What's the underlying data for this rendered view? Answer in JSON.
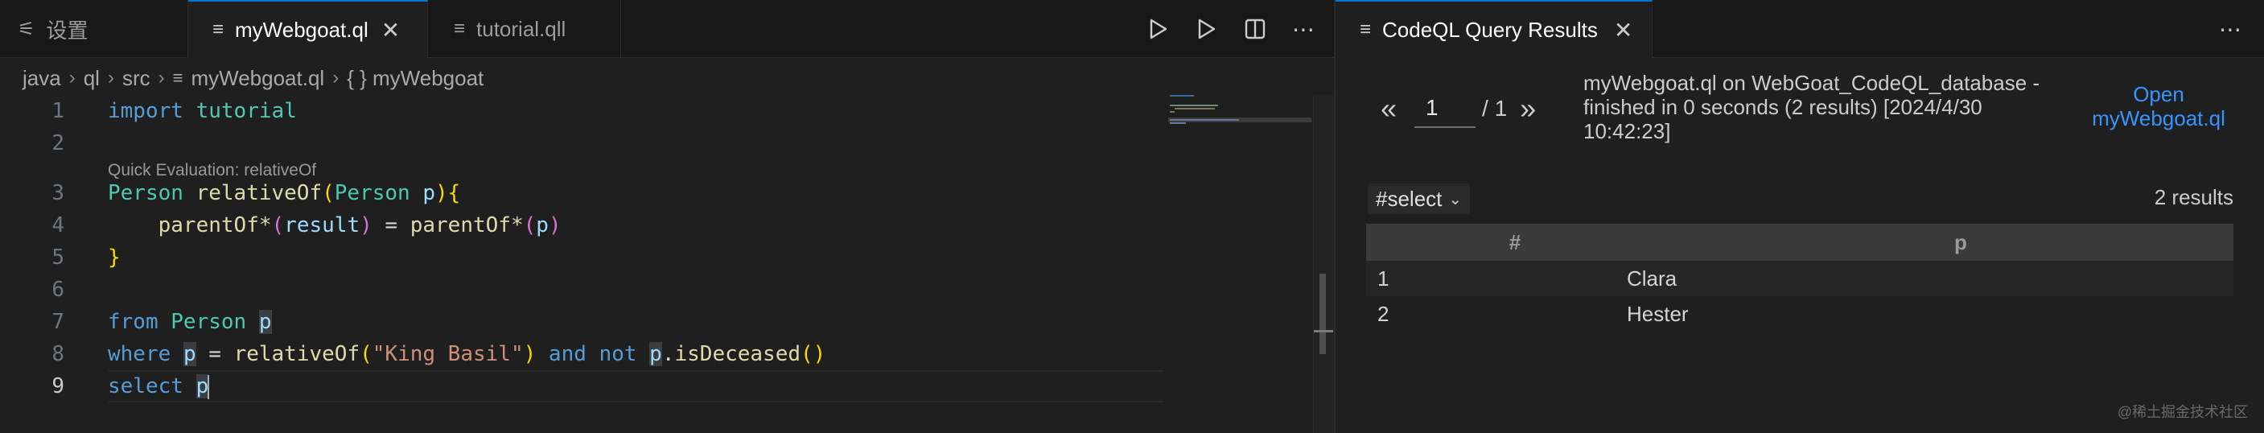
{
  "editor": {
    "tabs": [
      {
        "icon": "settings-icon",
        "label": "设置"
      },
      {
        "icon": "file-lines-icon",
        "label": "myWebgoat.ql"
      },
      {
        "icon": "file-lines-icon",
        "label": "tutorial.qll"
      }
    ],
    "close_glyph": "✕",
    "breadcrumb": [
      "java",
      "ql",
      "src",
      "myWebgoat.ql",
      "{ } myWebgoat"
    ],
    "code_lens": "Quick Evaluation: relativeOf",
    "line_numbers": [
      "1",
      "2",
      "3",
      "4",
      "5",
      "6",
      "7",
      "8",
      "9"
    ],
    "code": {
      "l1_kw": "import",
      "l1_mod": "tutorial",
      "l3_type": "Person",
      "l3_fn": "relativeOf",
      "l3_ptype": "Person",
      "l3_param": "p",
      "l4_fn1": "parentOf*",
      "l4_var1": "result",
      "l4_eq": "=",
      "l4_fn2": "parentOf*",
      "l4_var2": "p",
      "l7_kw": "from",
      "l7_type": "Person",
      "l7_var": "p",
      "l8_kw": "where",
      "l8_var": "p",
      "l8_fn": "relativeOf",
      "l8_str": "\"King Basil\"",
      "l8_and": "and",
      "l8_not": "not",
      "l8_var2": "p",
      "l8_method": "isDeceased",
      "l9_kw": "select",
      "l9_var": "p"
    }
  },
  "results": {
    "tab_label": "CodeQL Query Results",
    "page_current": "1",
    "page_total": "/ 1",
    "prev_glyph": "«",
    "next_glyph": "»",
    "summary": "myWebgoat.ql on WebGoat_CodeQL_database - finished in 0 seconds (2 results) [2024/4/30 10:42:23]",
    "open_link": "Open myWebgoat.ql",
    "select_value": "#select",
    "result_count": "2 results",
    "columns": [
      "#",
      "p"
    ],
    "rows": [
      {
        "index": "1",
        "value": "Clara"
      },
      {
        "index": "2",
        "value": "Hester"
      }
    ]
  },
  "watermark": "@稀土掘金技术社区"
}
